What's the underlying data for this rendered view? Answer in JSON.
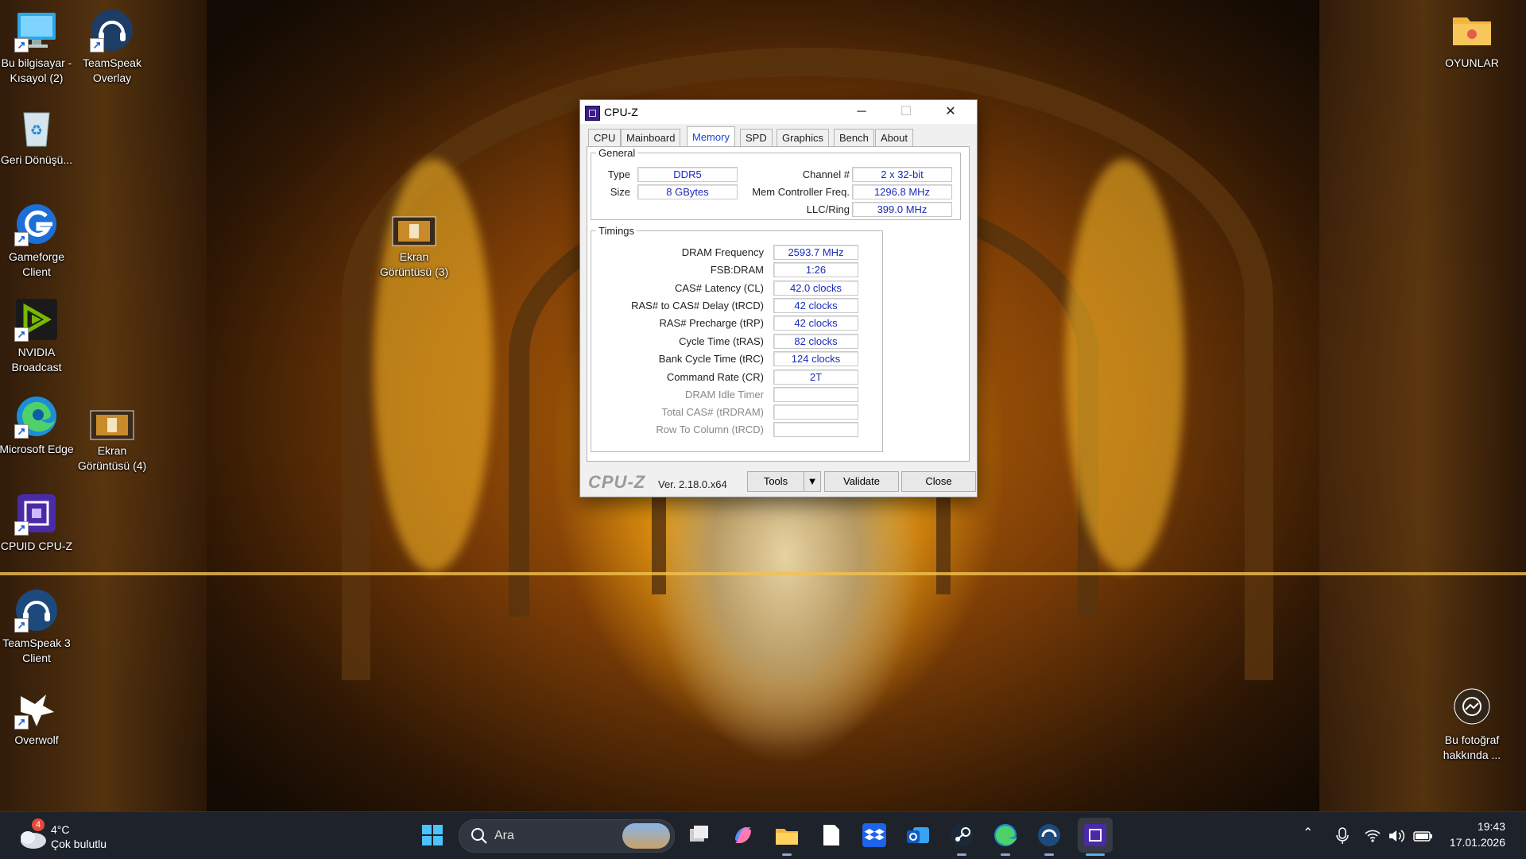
{
  "desktop": {
    "icons_left": [
      {
        "label": "Bu bilgisayar - Kısayol (2)",
        "icon": "monitor-icon"
      },
      {
        "label": "TeamSpeak Overlay",
        "icon": "headset-icon"
      },
      {
        "label": "Geri Dönüşü...",
        "icon": "recycle-bin-icon"
      },
      {
        "label": "Gameforge Client",
        "icon": "gameforge-icon"
      },
      {
        "label": "Ekran Görüntüsü (3)",
        "icon": "image-file-icon"
      },
      {
        "label": "NVIDIA Broadcast",
        "icon": "nvidia-icon"
      },
      {
        "label": "Microsoft Edge",
        "icon": "edge-icon"
      },
      {
        "label": "Ekran Görüntüsü (4)",
        "icon": "image-file-icon"
      },
      {
        "label": "CPUID CPU-Z",
        "icon": "cpu-chip-icon"
      },
      {
        "label": "TeamSpeak 3 Client",
        "icon": "headset-icon"
      },
      {
        "label": "Overwolf",
        "icon": "wolf-icon"
      }
    ],
    "oyunlar": "OYUNLAR",
    "photo_info": "Bu fotoğraf hakkında ..."
  },
  "cpuz": {
    "title": "CPU-Z",
    "tabs": [
      "CPU",
      "Mainboard",
      "Memory",
      "SPD",
      "Graphics",
      "Bench",
      "About"
    ],
    "active_tab": "Memory",
    "general": {
      "legend": "General",
      "type_label": "Type",
      "type_value": "DDR5",
      "size_label": "Size",
      "size_value": "8 GBytes",
      "channel_label": "Channel #",
      "channel_value": "2 x 32-bit",
      "mcf_label": "Mem Controller Freq.",
      "mcf_value": "1296.8 MHz",
      "llc_label": "LLC/Ring",
      "llc_value": "399.0 MHz"
    },
    "timings": {
      "legend": "Timings",
      "rows": [
        {
          "label": "DRAM Frequency",
          "value": "2593.7 MHz"
        },
        {
          "label": "FSB:DRAM",
          "value": "1:26"
        },
        {
          "label": "CAS# Latency (CL)",
          "value": "42.0 clocks"
        },
        {
          "label": "RAS# to CAS# Delay (tRCD)",
          "value": "42 clocks"
        },
        {
          "label": "RAS# Precharge (tRP)",
          "value": "42 clocks"
        },
        {
          "label": "Cycle Time (tRAS)",
          "value": "82 clocks"
        },
        {
          "label": "Bank Cycle Time (tRC)",
          "value": "124 clocks"
        },
        {
          "label": "Command Rate (CR)",
          "value": "2T"
        },
        {
          "label": "DRAM Idle Timer",
          "value": ""
        },
        {
          "label": "Total CAS# (tRDRAM)",
          "value": ""
        },
        {
          "label": "Row To Column (tRCD)",
          "value": ""
        }
      ]
    },
    "brand": "CPU-Z",
    "version": "Ver. 2.18.0.x64",
    "tools_label": "Tools",
    "validate_label": "Validate",
    "close_label": "Close"
  },
  "taskbar": {
    "weather_temp": "4°C",
    "weather_desc": "Çok bulutlu",
    "weather_badge": "4",
    "search_placeholder": "Ara",
    "time": "19:43",
    "date": "17.01.2026",
    "pinned": [
      "start-icon",
      "task-view-icon",
      "copilot-icon",
      "file-explorer-icon",
      "notepad-icon",
      "dropbox-icon",
      "outlook-icon",
      "steam-icon",
      "edge-icon",
      "teamspeak-icon",
      "cpuz-icon"
    ]
  },
  "colors": {
    "accent": "#1b44c8",
    "value_text": "#1b2bb8",
    "taskbar_bg": "#1e222a"
  }
}
